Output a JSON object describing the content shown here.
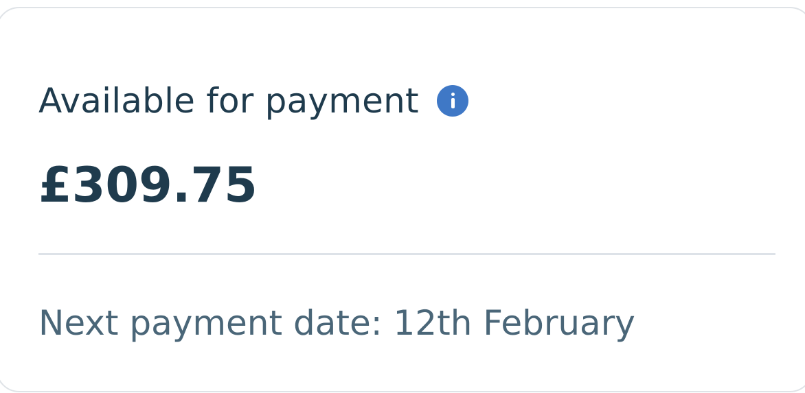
{
  "card": {
    "title": "Available for payment",
    "info_icon": "info-icon",
    "amount": "£309.75",
    "next_payment_text": "Next payment date: 12th February"
  },
  "colors": {
    "text_primary": "#1f3b4d",
    "text_secondary": "#4a6678",
    "accent": "#3f78c6",
    "divider": "#dde2e8",
    "card_border": "#dfe3e7"
  }
}
